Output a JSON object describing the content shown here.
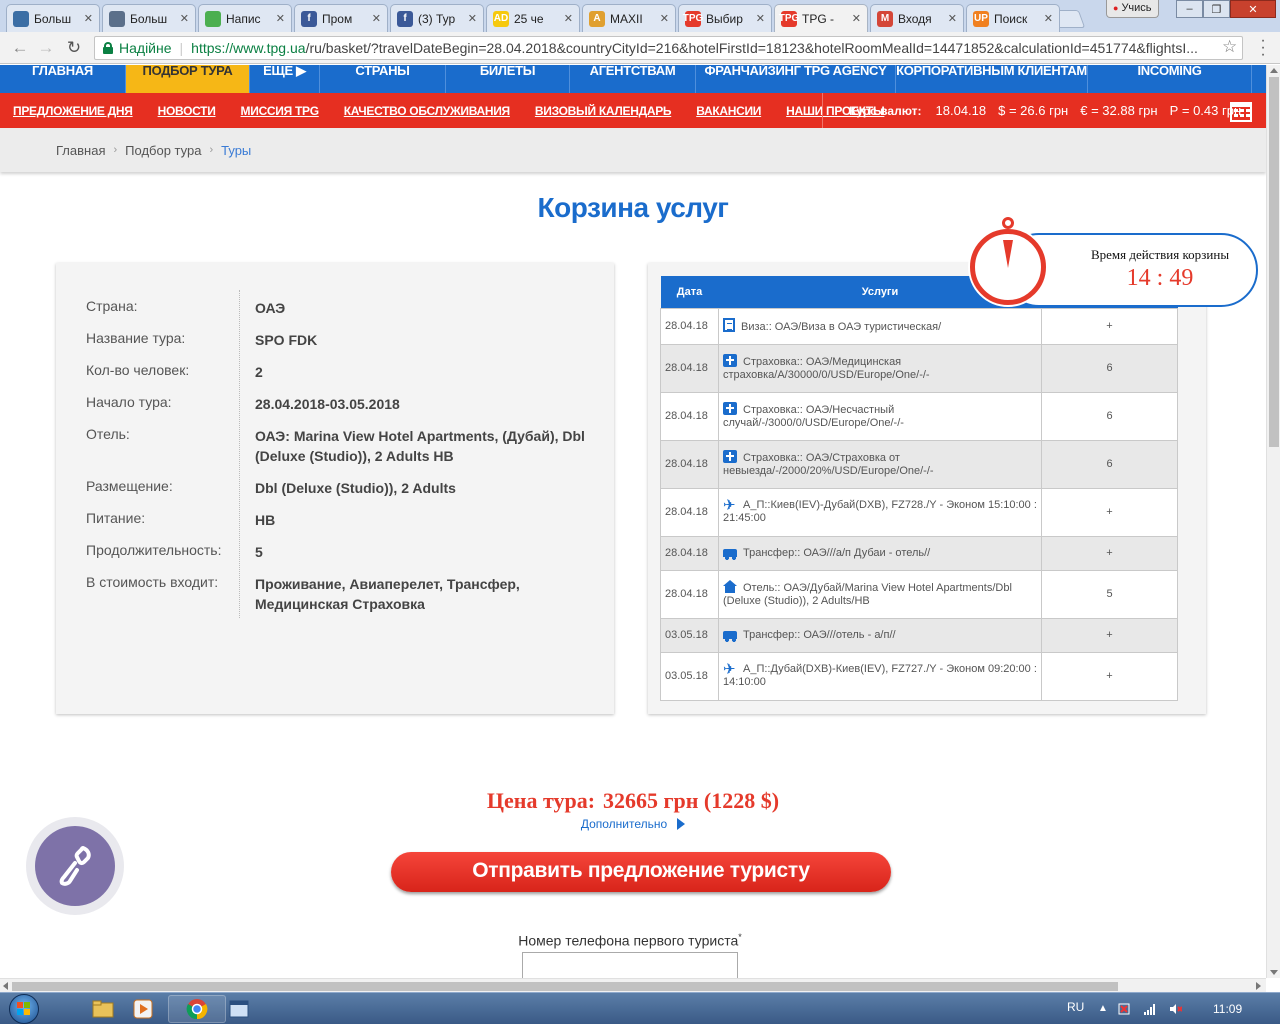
{
  "browser": {
    "tabs": [
      {
        "label": "Больш",
        "icon_text": "",
        "icon_color": "#3b6ea5",
        "icon": "refresh-icon"
      },
      {
        "label": "Больш",
        "icon_text": "",
        "icon_color": "#5b6f8a",
        "icon": "car-icon"
      },
      {
        "label": "Напис",
        "icon_text": "",
        "icon_color": "#4caf50",
        "icon": "mail-icon"
      },
      {
        "label": "Пром",
        "icon_text": "f",
        "icon_color": "#3b5998",
        "icon": "facebook-icon"
      },
      {
        "label": "(3) Тур",
        "icon_text": "f",
        "icon_color": "#3b5998",
        "icon": "facebook-icon"
      },
      {
        "label": "25 че",
        "icon_text": "AD",
        "icon_color": "#f6c90e",
        "icon": "ad-icon"
      },
      {
        "label": "MAXII",
        "icon_text": "A",
        "icon_color": "#e0a030",
        "icon": "maxi-icon"
      },
      {
        "label": "Выбир",
        "icon_text": "TPG",
        "icon_color": "#e53a2b",
        "icon": "tpg-icon"
      },
      {
        "label": "TPG -",
        "icon_text": "TPG",
        "icon_color": "#e53a2b",
        "icon": "tpg-icon"
      },
      {
        "label": "Входя",
        "icon_text": "M",
        "icon_color": "#d44638",
        "icon": "gmail-icon"
      },
      {
        "label": "Поиск",
        "icon_text": "UP",
        "icon_color": "#f08020",
        "icon": "search-site-icon"
      }
    ],
    "active_tab": 8,
    "user_label": "Учись",
    "secure_label": "Надійне",
    "url_host": "https://www.tpg.ua",
    "url_rest": "/ru/basket/?travelDateBegin=28.04.2018&countryCityId=216&hotelFirstId=18123&hotelRoomMealId=14471852&calculationId=451774&flightsI..."
  },
  "main_nav": [
    {
      "label": "ГЛАВНАЯ",
      "active": false
    },
    {
      "label": "ПОДБОР ТУРА",
      "active": true
    },
    {
      "label": "ЕЩЕ ▶",
      "active": false
    },
    {
      "label": "СТРАНЫ",
      "active": false
    },
    {
      "label": "БИЛЕТЫ",
      "active": false
    },
    {
      "label": "АГЕНТСТВАМ",
      "active": false
    },
    {
      "label": "ФРАНЧАЙЗИНГ TPG AGENCY",
      "active": false
    },
    {
      "label": "КОРПОРАТИВНЫМ КЛИЕНТАМ",
      "active": false
    },
    {
      "label": "INCOMING",
      "active": false
    }
  ],
  "sub_nav": [
    "ПРЕДЛОЖЕНИЕ ДНЯ",
    "НОВОСТИ",
    "МИССИЯ TPG",
    "КАЧЕСТВО ОБСЛУЖИВАНИЯ",
    "ВИЗОВЫЙ КАЛЕНДАРЬ",
    "ВАКАНСИИ",
    "НАШИ ПРОЕКТЫ"
  ],
  "rates": {
    "label": "Курс валют:",
    "date": "18.04.18",
    "usd": "$ = 26.6 грн",
    "eur": "€ = 32.88 грн",
    "rub": "Р = 0.43 грн"
  },
  "breadcrumb": [
    "Главная",
    "Подбор тура",
    "Туры"
  ],
  "title": "Корзина услуг",
  "tour_info": [
    {
      "label": "Страна:",
      "value": "ОАЭ"
    },
    {
      "label": "Название тура:",
      "value": "SPO FDK"
    },
    {
      "label": "Кол-во человек:",
      "value": "2"
    },
    {
      "label": "Начало тура:",
      "value": "28.04.2018-03.05.2018"
    },
    {
      "label": "Отель:",
      "value": "ОАЭ: Marina View Hotel Apartments, (Дубай), Dbl (Deluxe (Studio)), 2 Adults HB"
    },
    {
      "label": "Размещение:",
      "value": "Dbl (Deluxe (Studio)), 2 Adults"
    },
    {
      "label": "Питание:",
      "value": "HB"
    },
    {
      "label": "Продолжительность:",
      "value": "5"
    },
    {
      "label": "В стоимость входит:",
      "value": "Проживание, Авиаперелет, Трансфер, Медицинская Страховка"
    }
  ],
  "services": {
    "headers": [
      "Дата",
      "Услуги"
    ],
    "rows": [
      {
        "date": "28.04.18",
        "icon": "document-icon",
        "text": "Виза:: ОАЭ/Виза в ОАЭ туристическая/",
        "qty": "+"
      },
      {
        "date": "28.04.18",
        "icon": "medkit-icon",
        "text": "Страховка:: ОАЭ/Медицинская страховка/A/30000/0/USD/Europe/One/-/-",
        "qty": "6"
      },
      {
        "date": "28.04.18",
        "icon": "medkit-icon",
        "text": "Страховка:: ОАЭ/Несчастный случай/-/3000/0/USD/Europe/One/-/-",
        "qty": "6"
      },
      {
        "date": "28.04.18",
        "icon": "medkit-icon",
        "text": "Страховка:: ОАЭ/Страховка от невыезда/-/2000/20%/USD/Europe/One/-/-",
        "qty": "6"
      },
      {
        "date": "28.04.18",
        "icon": "plane-icon",
        "text": "А_П::Киев(IEV)-Дубай(DXB), FZ728./Y - Эконом 15:10:00 : 21:45:00",
        "qty": "+"
      },
      {
        "date": "28.04.18",
        "icon": "bus-icon",
        "text": "Трансфер:: ОАЭ///а/п Дубаи - отель//",
        "qty": "+"
      },
      {
        "date": "28.04.18",
        "icon": "house-icon",
        "text": "Отель:: ОАЭ/Дубай/Marina View Hotel Apartments/Dbl (Deluxe (Studio)), 2 Adults/HB",
        "qty": "5"
      },
      {
        "date": "03.05.18",
        "icon": "bus-icon",
        "text": "Трансфер:: ОАЭ///отель - а/п//",
        "qty": "+"
      },
      {
        "date": "03.05.18",
        "icon": "plane-icon",
        "text": "А_П::Дубай(DXB)-Киев(IEV), FZ727./Y - Эконом 09:20:00 : 14:10:00",
        "qty": "+"
      }
    ]
  },
  "timer": {
    "label": "Время действия корзины",
    "value": "14 : 49"
  },
  "price": {
    "label": "Цена тура:",
    "value": "32665 грн (1228 $)"
  },
  "more_label": "Дополнительно",
  "send_button": "Отправить предложение туристу",
  "phone_field": {
    "label": "Номер телефона первого туриста",
    "required_mark": "*",
    "value": ""
  },
  "taskbar": {
    "lang": "RU",
    "time": "11:09"
  },
  "colors": {
    "brand_blue": "#1a6ccc",
    "brand_red": "#e62f21",
    "accent_yellow": "#f6b716",
    "price_red": "#e53a2b"
  }
}
